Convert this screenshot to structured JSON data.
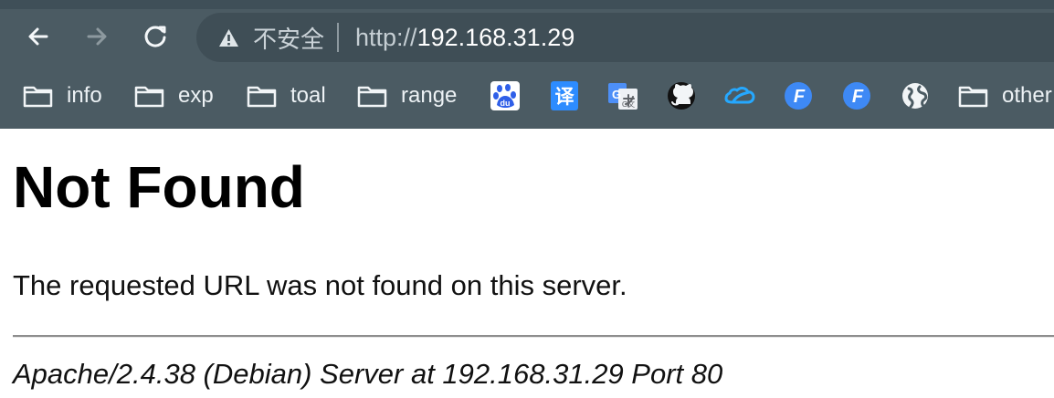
{
  "browser": {
    "security_label": "不安全",
    "url_scheme": "http://",
    "url_host": "192.168.31.29",
    "icons": {
      "back": "back-arrow-icon",
      "forward": "forward-arrow-icon",
      "reload": "reload-icon",
      "security": "warning-triangle-icon"
    }
  },
  "bookmarks": {
    "folders": [
      {
        "label": "info",
        "icon": "folder-icon"
      },
      {
        "label": "exp",
        "icon": "folder-icon"
      },
      {
        "label": "toal",
        "icon": "folder-icon"
      },
      {
        "label": "range",
        "icon": "folder-icon"
      }
    ],
    "shortcut_icons": [
      {
        "icon": "baidu-icon",
        "text": "du"
      },
      {
        "icon": "translate-icon",
        "text": "译"
      },
      {
        "icon": "google-translate-icon",
        "text": "G文"
      },
      {
        "icon": "github-icon"
      },
      {
        "icon": "cloud-icon"
      },
      {
        "icon": "fast-f-icon",
        "text": "F"
      },
      {
        "icon": "fast-f-icon",
        "text": "F"
      },
      {
        "icon": "globe-icon"
      }
    ],
    "overflow_folder": {
      "label": "other",
      "icon": "folder-icon"
    }
  },
  "page": {
    "title": "Not Found",
    "message": "The requested URL was not found on this server.",
    "signature": "Apache/2.4.38 (Debian) Server at 192.168.31.29 Port 80"
  },
  "colors": {
    "toolbar": "#4b5b63",
    "omnibox": "#3f4e56",
    "page_background": "#ffffff",
    "baidu_blue": "#2f5fe8",
    "translate_blue": "#2d8cff",
    "fast_blue": "#3e89f5",
    "cloud_blue": "#25a8ff"
  }
}
